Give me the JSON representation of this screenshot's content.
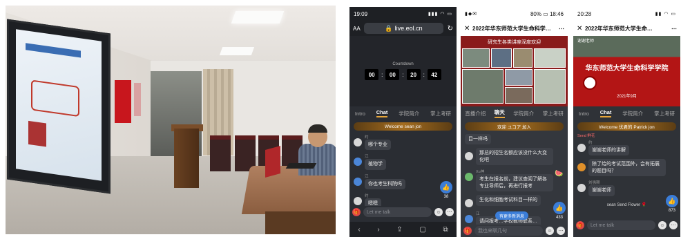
{
  "phone1": {
    "time": "19:09",
    "url_aa": "AA",
    "url": "live.eol.cn",
    "countdown": {
      "label": "Countdown",
      "hh": "00",
      "mm": "00",
      "ss": "20",
      "ff": "42"
    },
    "tabs": [
      "Intro",
      "Chat",
      "学院简介",
      "掌上考研"
    ],
    "welcome": "Welcome  sean  jon",
    "messages": [
      {
        "name": "约",
        "text": "哪个专业"
      },
      {
        "name": "江",
        "text": "植物学"
      },
      {
        "name": "江",
        "text": "你也考生科院吗"
      },
      {
        "name": "约",
        "text": "嗯嗯"
      }
    ],
    "likes": "38",
    "input_placeholder": "Let me talk",
    "nav": [
      "‹",
      "›",
      "⇪",
      "▢",
      "⧉"
    ]
  },
  "phone2": {
    "time": "18:46",
    "battery": "80%",
    "title": "2022年华东师范大学生命科学学院…",
    "banner": "研究生各类讲座深度欢迎",
    "tabs": [
      "直播介绍",
      "聊天",
      "学院简介",
      "掌上考研"
    ],
    "welcome": "欢迎  ユコア  加入",
    "messages": [
      {
        "name": "",
        "text": "目一样吗"
      },
      {
        "name": "",
        "text": "那总的招生名额应该没什么大变化吧"
      },
      {
        "name": "Xu神",
        "text": "考生在报名前，建议查阅了解各专业导师后，再进行报考"
      },
      {
        "name": "",
        "text": "生化和细胞考试科目一样的"
      },
      {
        "name": "江",
        "text": "请问报考…学校教师联系…"
      }
    ],
    "more_messages": "有更多新消息",
    "likes": "433",
    "input_placeholder": "我也来聊几句"
  },
  "phone3": {
    "time": "20:28",
    "title": "2022年华东师范大学生命…",
    "video_title": "华东师范大学生命科学学院",
    "video_top": "谢谢老师",
    "video_date": "2021年9月",
    "tabs": [
      "Intro",
      "Chat",
      "学院简介",
      "掌上考研"
    ],
    "welcome": "Welcome  优君的 Patrick  jon",
    "gift_top": "Send 鲜花",
    "messages": [
      {
        "name": "约",
        "text": "谢谢老师的讲解"
      },
      {
        "name": "",
        "text": "除了给的考试范围外，会有拓展的题目吗？"
      },
      {
        "name": "刘强期",
        "text": "谢谢老师"
      }
    ],
    "gift_line": "sean  Send  Flower",
    "likes": "873",
    "input_placeholder": "Let me talk"
  }
}
